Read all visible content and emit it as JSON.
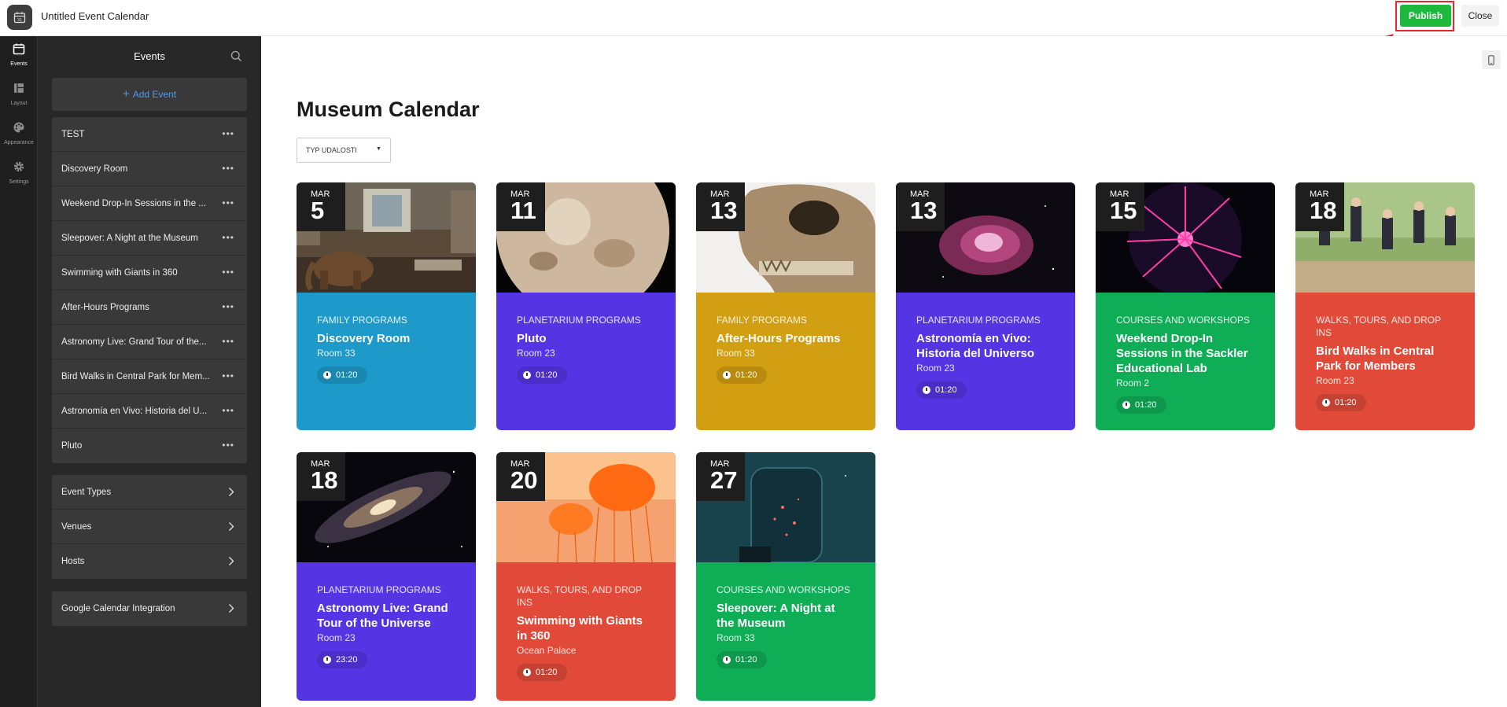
{
  "app": {
    "title": "Untitled Event Calendar",
    "publish_label": "Publish",
    "close_label": "Close"
  },
  "rail": {
    "items": [
      {
        "label": "Events",
        "icon": "calendar-icon",
        "active": true
      },
      {
        "label": "Layout",
        "icon": "layout-icon",
        "active": false
      },
      {
        "label": "Appearance",
        "icon": "palette-icon",
        "active": false
      },
      {
        "label": "Settings",
        "icon": "gear-icon",
        "active": false
      }
    ]
  },
  "panel": {
    "title": "Events",
    "add_label": "Add Event",
    "events": [
      "TEST",
      "Discovery Room",
      "Weekend Drop-In Sessions in the ...",
      "Sleepover: A Night at the Museum",
      "Swimming with Giants in 360",
      "After-Hours Programs",
      "Astronomy Live: Grand Tour of the...",
      "Bird Walks in Central Park for Mem...",
      "Astronomía en Vivo: Historia del U...",
      "Pluto"
    ],
    "sections": [
      "Event Types",
      "Venues",
      "Hosts"
    ],
    "integration_label": "Google Calendar Integration"
  },
  "main": {
    "title": "Museum Calendar",
    "filter_label": "TYP UDALOSTI",
    "cards": [
      {
        "month": "MAR",
        "day": "5",
        "type": "FAMILY PROGRAMS",
        "title": "Discovery Room",
        "venue": "Room 33",
        "time": "01:20",
        "color": "#1d9ac9",
        "image": "museum-hall"
      },
      {
        "month": "MAR",
        "day": "11",
        "type": "PLANETARIUM PROGRAMS",
        "title": "Pluto",
        "venue": "Room 23",
        "time": "01:20",
        "color": "#5535e3",
        "image": "pluto"
      },
      {
        "month": "MAR",
        "day": "13",
        "type": "FAMILY PROGRAMS",
        "title": "After-Hours Programs",
        "venue": "Room 33",
        "time": "01:20",
        "color": "#d29e12",
        "image": "skull"
      },
      {
        "month": "MAR",
        "day": "13",
        "type": "PLANETARIUM PROGRAMS",
        "title": "Astronomía en Vivo: Historia del Universo",
        "venue": "Room 23",
        "time": "01:20",
        "color": "#5535e3",
        "image": "nebula"
      },
      {
        "month": "MAR",
        "day": "15",
        "type": "COURSES AND WORKSHOPS",
        "title": "Weekend Drop-In Sessions in the Sackler Educational Lab",
        "venue": "Room 2",
        "time": "01:20",
        "color": "#10ad57",
        "image": "plasma-ball"
      },
      {
        "month": "MAR",
        "day": "18",
        "type": "WALKS, TOURS, AND DROP INS",
        "title": "Bird Walks in Central Park for Members",
        "venue": "Room 23",
        "time": "01:20",
        "color": "#e14a38",
        "image": "jumping-people"
      },
      {
        "month": "MAR",
        "day": "18",
        "type": "PLANETARIUM PROGRAMS",
        "title": "Astronomy Live: Grand Tour of the Universe",
        "venue": "Room 23",
        "time": "23:20",
        "color": "#5535e3",
        "image": "galaxy"
      },
      {
        "month": "MAR",
        "day": "20",
        "type": "WALKS, TOURS, AND DROP INS",
        "title": "Swimming with Giants in 360",
        "venue": "Ocean Palace",
        "time": "01:20",
        "color": "#e14a38",
        "image": "jellyfish"
      },
      {
        "month": "MAR",
        "day": "27",
        "type": "COURSES AND WORKSHOPS",
        "title": "Sleepover: A Night at the Museum",
        "venue": "Room 33",
        "time": "01:20",
        "color": "#10ad57",
        "image": "jar-of-stars"
      }
    ]
  }
}
